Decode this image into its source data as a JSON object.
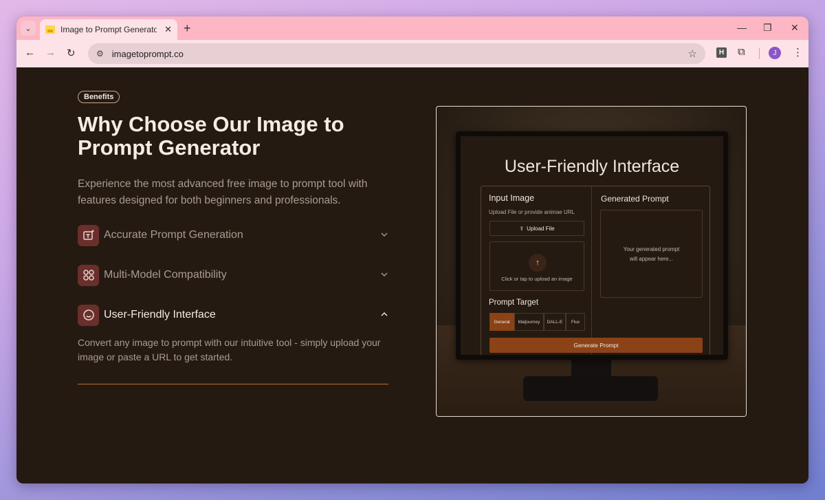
{
  "browser": {
    "tab_title": "Image to Prompt Generator | Tu",
    "url": "imagetoprompt.co",
    "extension_label": "H",
    "profile_initial": "J"
  },
  "page": {
    "badge": "Benefits",
    "headline": "Why Choose Our Image to Prompt Generator",
    "subtitle": "Experience the most advanced free image to prompt tool with features designed for both beginners and professionals.",
    "accordion": [
      {
        "label": "Accurate Prompt Generation",
        "icon": "text-sparkle-icon",
        "expanded": false
      },
      {
        "label": "Multi-Model Compatibility",
        "icon": "grid-icon",
        "expanded": false
      },
      {
        "label": "User-Friendly Interface",
        "icon": "smile-icon",
        "expanded": true
      }
    ],
    "expanded_description": "Convert any image to prompt with our intuitive tool - simply upload your image or paste a URL to get started."
  },
  "illustration": {
    "screen_title": "User-Friendly Interface",
    "input_heading": "Input Image",
    "input_hint": "Upload File or provide animae URL",
    "upload_button": "Upload File",
    "dropzone_text": "Click or tap to upload an image",
    "target_heading": "Prompt Target",
    "targets": [
      "General",
      "Maljourney",
      "DALL-E",
      "Flux"
    ],
    "active_target": "General",
    "output_heading": "Generated Prompt",
    "output_placeholder_line1": "Your generated prompt",
    "output_placeholder_line2": "will appear here...",
    "generate_button": "Generate Prompt"
  },
  "colors": {
    "page_bg": "#251a12",
    "accent": "#b86f2a",
    "icon_bg": "#6a2f2b",
    "browser_chrome": "#fdb6c4"
  }
}
